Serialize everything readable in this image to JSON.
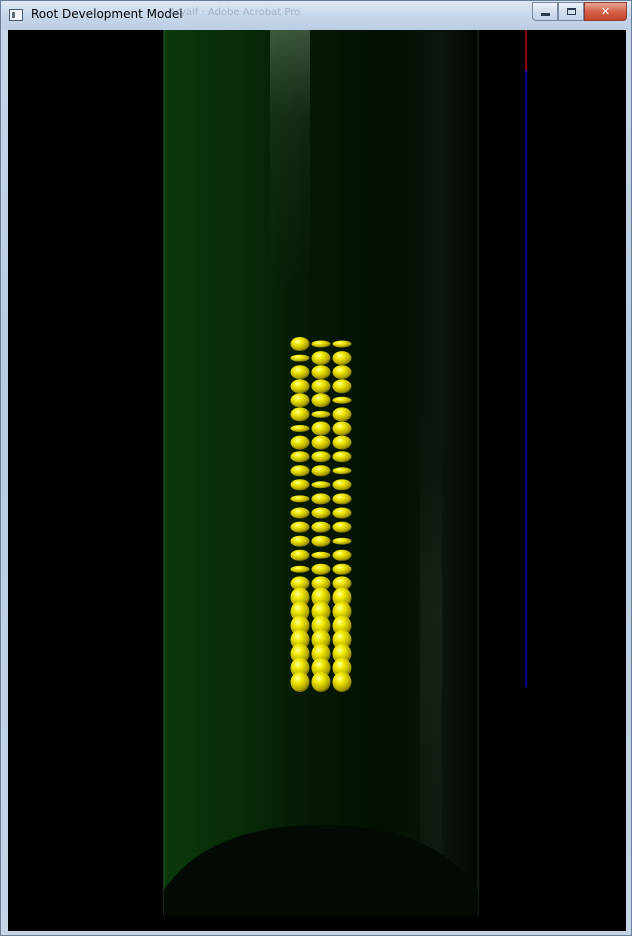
{
  "window": {
    "title": "Root Development Model",
    "ghost_title": "Aryalf · Adobe Acrobat Pro",
    "buttons": {
      "minimize": "minimize",
      "maximize": "maximize",
      "close": "✕"
    }
  },
  "scene": {
    "background_color": "#000000",
    "cylinder_color": "#0b3a0b",
    "cell_color": "#e0d800",
    "axis_colors": {
      "x": "#c00000",
      "y": "#0000c8"
    },
    "cell_columns": 3,
    "cell_rows": 25
  }
}
